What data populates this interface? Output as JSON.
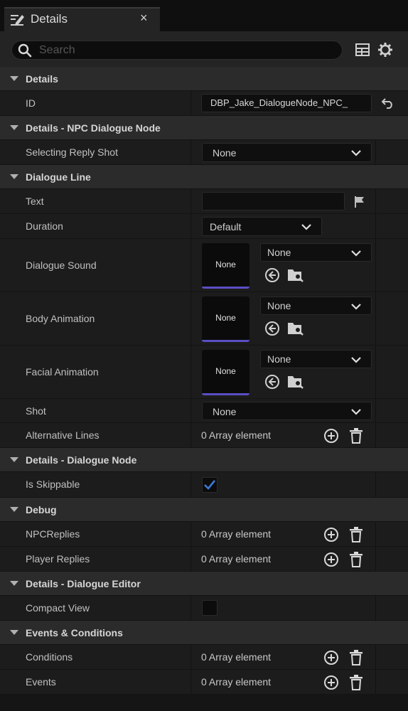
{
  "tab": {
    "title": "Details",
    "close": "×"
  },
  "search": {
    "placeholder": "Search"
  },
  "sections": {
    "details": {
      "label": "Details",
      "id_label": "ID",
      "id_value": "DBP_Jake_DialogueNode_NPC_"
    },
    "npc": {
      "label": "Details - NPC Dialogue Node",
      "reply_shot_label": "Selecting Reply Shot",
      "reply_shot_value": "None"
    },
    "line": {
      "label": "Dialogue Line",
      "text_label": "Text",
      "text_value": "",
      "duration_label": "Duration",
      "duration_value": "Default",
      "sound_label": "Dialogue Sound",
      "sound_thumb": "None",
      "sound_value": "None",
      "body_label": "Body Animation",
      "body_thumb": "None",
      "body_value": "None",
      "facial_label": "Facial Animation",
      "facial_thumb": "None",
      "facial_value": "None",
      "shot_label": "Shot",
      "shot_value": "None",
      "alt_label": "Alternative Lines",
      "alt_value": "0 Array element"
    },
    "dnode": {
      "label": "Details - Dialogue Node",
      "skippable_label": "Is Skippable",
      "skippable": true
    },
    "debug": {
      "label": "Debug",
      "npc_label": "NPCReplies",
      "npc_value": "0 Array element",
      "player_label": "Player Replies",
      "player_value": "0 Array element"
    },
    "editor": {
      "label": "Details - Dialogue Editor",
      "compact_label": "Compact View",
      "compact": false
    },
    "events": {
      "label": "Events & Conditions",
      "cond_label": "Conditions",
      "cond_value": "0 Array element",
      "events_label": "Events",
      "events_value": "0 Array element"
    }
  },
  "colors": {
    "accent": "#5a4ec4",
    "check": "#3a7bd5"
  }
}
